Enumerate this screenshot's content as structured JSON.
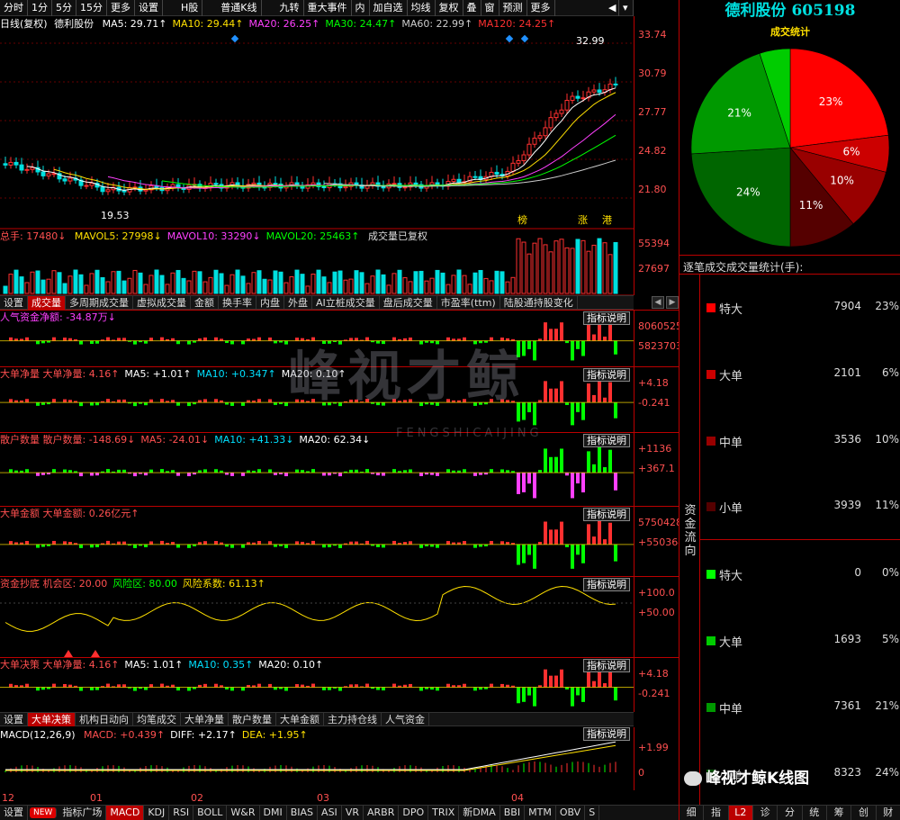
{
  "toolbar": {
    "items": [
      "分时",
      "1分",
      "5分",
      "15分",
      "更多",
      "设置",
      "H股",
      "普通K线",
      "九转",
      "重大事件",
      "内",
      "加自选",
      "均线",
      "复权",
      "叠",
      "窗",
      "预测",
      "更多"
    ]
  },
  "kline": {
    "title": "日线(复权)",
    "name": "德利股份",
    "ma": [
      {
        "label": "MA5: 29.71↑",
        "color": "#ffffff"
      },
      {
        "label": "MA10: 29.44↑",
        "color": "#ffe000"
      },
      {
        "label": "MA20: 26.25↑",
        "color": "#ff40ff"
      },
      {
        "label": "MA30: 24.47↑",
        "color": "#00ff00"
      },
      {
        "label": "MA60: 22.99↑",
        "color": "#cccccc"
      },
      {
        "label": "MA120: 24.25↑",
        "color": "#ff3030"
      }
    ],
    "price_labels": [
      "33.74",
      "30.79",
      "27.77",
      "24.82",
      "21.80"
    ],
    "high_label": "32.99",
    "low_label": "19.53",
    "markers": [
      "榜",
      "涨",
      "港"
    ]
  },
  "volume": {
    "title": "总手: 17480↓",
    "ma": [
      {
        "label": "MAVOL5: 27998↓",
        "color": "#ffe000"
      },
      {
        "label": "MAVOL10: 33290↓",
        "color": "#ff40ff"
      },
      {
        "label": "MAVOL20: 25463↑",
        "color": "#00ff00"
      }
    ],
    "note": "成交量已复权",
    "labels": [
      "55394",
      "27697"
    ]
  },
  "tabs1": [
    "设置",
    "成交量",
    "多周期成交量",
    "虚拟成交量",
    "金额",
    "换手率",
    "内盘",
    "外盘",
    "AI立桩成交量",
    "盘后成交量",
    "市盈率(ttm)",
    "陆股通持股变化"
  ],
  "panels": [
    {
      "title": "人气资金净额: -34.87万↓",
      "title_color": "#ff40ff",
      "labels": [
        "8060525",
        "5823703"
      ],
      "explain": "指标说明"
    },
    {
      "title": "大单净量 大单净量: 4.16↑",
      "extra": [
        {
          "label": "MA5: +1.01↑",
          "color": "#ffffff"
        },
        {
          "label": "MA10: +0.347↑",
          "color": "#00e0ff"
        },
        {
          "label": "MA20: 0.10↑",
          "color": "#ffffff"
        }
      ],
      "labels": [
        "+4.18",
        "-0.241"
      ],
      "explain": "指标说明"
    },
    {
      "title": "散户数量 散户数量: -148.69↓",
      "extra": [
        {
          "label": "MA5: -24.01↓",
          "color": "#ff5050"
        },
        {
          "label": "MA10: +41.33↓",
          "color": "#00e0ff"
        },
        {
          "label": "MA20: 62.34↓",
          "color": "#ffffff"
        }
      ],
      "labels": [
        "+1136",
        "+367.1"
      ],
      "explain": "指标说明"
    },
    {
      "title": "大单金额 大单金额: 0.26亿元↑",
      "extra": [],
      "labels": [
        "5750428",
        "+550364"
      ],
      "explain": "指标说明"
    },
    {
      "title": "资金抄底 机会区: 20.00",
      "extra": [
        {
          "label": "风险区: 80.00",
          "color": "#00ff00"
        },
        {
          "label": "风险系数: 61.13↑",
          "color": "#ffe000"
        }
      ],
      "labels": [
        "+100.0",
        "+50.00"
      ],
      "explain": "指标说明"
    },
    {
      "title": "大单决策 大单净量: 4.16↑",
      "extra": [
        {
          "label": "MA5: 1.01↑",
          "color": "#ffffff"
        },
        {
          "label": "MA10: 0.35↑",
          "color": "#00e0ff"
        },
        {
          "label": "MA20: 0.10↑",
          "color": "#ffffff"
        }
      ],
      "labels": [
        "+4.18",
        "-0.241"
      ],
      "explain": "指标说明"
    }
  ],
  "tabs2": [
    "设置",
    "大单决策",
    "机构日动向",
    "均笔成交",
    "大单净量",
    "散户数量",
    "大单金额",
    "主力持仓线",
    "人气资金"
  ],
  "macd": {
    "title": "MACD(12,26,9)",
    "extra": [
      {
        "label": "MACD: +0.439↑",
        "color": "#ff5050"
      },
      {
        "label": "DIFF: +2.17↑",
        "color": "#ffffff"
      },
      {
        "label": "DEA: +1.95↑",
        "color": "#ffe000"
      }
    ],
    "labels": [
      "+1.99",
      "0"
    ],
    "months": [
      "12",
      "01",
      "02",
      "03",
      "04"
    ],
    "explain": "指标说明"
  },
  "bottombar": [
    "设置",
    "NEW",
    "指标广场",
    "MACD",
    "KDJ",
    "RSI",
    "BOLL",
    "W&R",
    "DMI",
    "BIAS",
    "ASI",
    "VR",
    "ARBR",
    "DPO",
    "TRIX",
    "新DMA",
    "BBI",
    "MTM",
    "OBV",
    "S"
  ],
  "right": {
    "title": "德利股份 605198",
    "pie_title": "成交统计",
    "pie": [
      {
        "label": "23%",
        "value": 23,
        "color": "#ff0000"
      },
      {
        "label": "6%",
        "value": 6,
        "color": "#cc0000"
      },
      {
        "label": "10%",
        "value": 10,
        "color": "#990000"
      },
      {
        "label": "11%",
        "value": 11,
        "color": "#550000"
      },
      {
        "label": "24%",
        "value": 24,
        "color": "#006600"
      },
      {
        "label": "21%",
        "value": 21,
        "color": "#009900"
      },
      {
        "label": "",
        "value": 5,
        "color": "#00cc00"
      }
    ],
    "stat_title": "逐笔成交成交量统计(手):",
    "fund_label": "资金流向",
    "rows": [
      {
        "name": "特大",
        "vol": "7904",
        "pct": "23%",
        "color": "#ff0000"
      },
      {
        "name": "大单",
        "vol": "2101",
        "pct": "6%",
        "color": "#cc0000"
      },
      {
        "name": "中单",
        "vol": "3536",
        "pct": "10%",
        "color": "#990000"
      },
      {
        "name": "小单",
        "vol": "3939",
        "pct": "11%",
        "color": "#550000"
      },
      {
        "name": "特大",
        "vol": "0",
        "pct": "0%",
        "color": "#00ff00"
      },
      {
        "name": "大单",
        "vol": "1693",
        "pct": "5%",
        "color": "#00cc00"
      },
      {
        "name": "中单",
        "vol": "7361",
        "pct": "21%",
        "color": "#009900"
      },
      {
        "name": "小单",
        "vol": "8323",
        "pct": "24%",
        "color": "#006600"
      }
    ],
    "bottom_tabs": [
      "细",
      "指",
      "L2",
      "诊",
      "分",
      "统",
      "筹",
      "创",
      "财"
    ]
  },
  "watermark": {
    "text": "峰视才鲸",
    "sub": "FENGSHICAIJING",
    "brand": "峰视才鲸K线图"
  }
}
